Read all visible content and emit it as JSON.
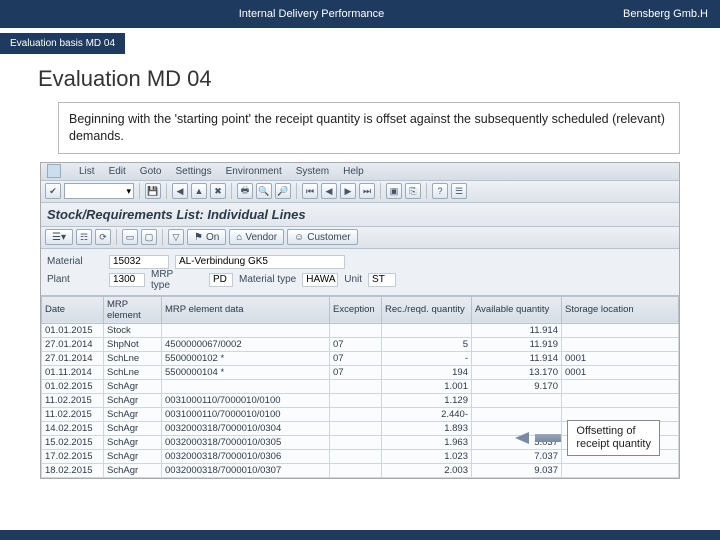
{
  "header": {
    "center": "Internal Delivery Performance",
    "right": "Bensberg Gmb.H"
  },
  "breadcrumb": {
    "tab": "Evaluation basis MD 04"
  },
  "page": {
    "title": "Evaluation MD 04",
    "desc": "Beginning with the 'starting point' the receipt quantity is offset against the subsequently scheduled (relevant) demands."
  },
  "sap": {
    "menu": [
      "List",
      "Edit",
      "Goto",
      "Settings",
      "Environment",
      "System",
      "Help"
    ],
    "subtitle": "Stock/Requirements List: Individual Lines",
    "toolbar2": {
      "on": "On",
      "vendor": "Vendor",
      "customer": "Customer"
    }
  },
  "info": {
    "material_lbl": "Material",
    "material_val": "15032",
    "material_desc": "AL-Verbindung GK5",
    "plant_lbl": "Plant",
    "plant_val": "1300",
    "mrptype_lbl": "MRP type",
    "mrptype_val": "PD",
    "mattype_lbl": "Material type",
    "mattype_val": "HAWA",
    "unit_lbl": "Unit",
    "unit_val": "ST"
  },
  "grid": {
    "cols": [
      "Date",
      "MRP element",
      "MRP element data",
      "Exception",
      "Rec./reqd. quantity",
      "Available quantity",
      "Storage location"
    ],
    "rows": [
      {
        "d": "01.01.2015",
        "e": "Stock",
        "m": "",
        "x": "",
        "r": "",
        "a": "11.914",
        "s": ""
      },
      {
        "d": "27.01.2014",
        "e": "ShpNot",
        "m": "4500000067/0002",
        "x": "07",
        "r": "5",
        "a": "11.919",
        "s": ""
      },
      {
        "d": "27.01.2014",
        "e": "SchLne",
        "m": "5500000102 *",
        "x": "07",
        "r": "-",
        "a": "11.914",
        "s": "0001"
      },
      {
        "d": "01.11.2014",
        "e": "SchLne",
        "m": "5500000104 *",
        "x": "07",
        "r": "194",
        "a": "13.170",
        "s": "0001"
      },
      {
        "d": "01.02.2015",
        "e": "SchAgr",
        "m": "",
        "x": "",
        "r": "1.001",
        "a": "9.170",
        "s": ""
      },
      {
        "d": "11.02.2015",
        "e": "SchAgr",
        "m": "0031000110/7000010/0100",
        "x": "",
        "r": "1.129",
        "a": "",
        "s": ""
      },
      {
        "d": "11.02.2015",
        "e": "SchAgr",
        "m": "0031000110/7000010/0100",
        "x": "",
        "r": "2.440-",
        "a": "",
        "s": ""
      },
      {
        "d": "14.02.2015",
        "e": "SchAgr",
        "m": "0032000318/7000010/0304",
        "x": "",
        "r": "1.893",
        "a": "",
        "s": ""
      },
      {
        "d": "15.02.2015",
        "e": "SchAgr",
        "m": "0032000318/7000010/0305",
        "x": "",
        "r": "1.963",
        "a": "5.037",
        "s": ""
      },
      {
        "d": "17.02.2015",
        "e": "SchAgr",
        "m": "0032000318/7000010/0306",
        "x": "",
        "r": "1.023",
        "a": "7.037",
        "s": ""
      },
      {
        "d": "18.02.2015",
        "e": "SchAgr",
        "m": "0032000318/7000010/0307",
        "x": "",
        "r": "2.003",
        "a": "9.037",
        "s": ""
      }
    ]
  },
  "callout": {
    "line1": "Offsetting of",
    "line2": "receipt quantity"
  }
}
